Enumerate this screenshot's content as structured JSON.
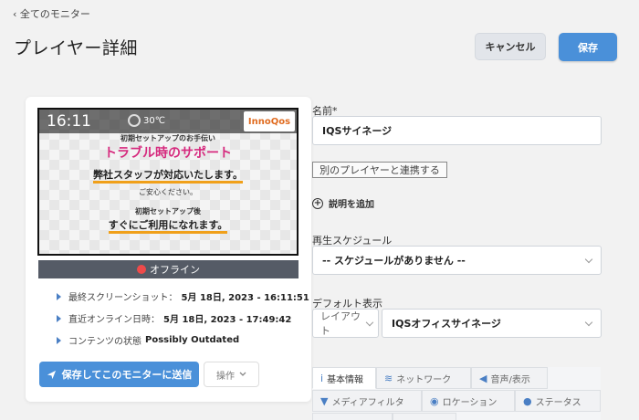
{
  "header": {
    "back_link": "‹ 全てのモニター",
    "title": "プレイヤー詳細",
    "cancel_label": "キャンセル",
    "save_label": "保存"
  },
  "preview": {
    "time": "16:11",
    "weather_icon": "sun-icon",
    "temperature": "30℃",
    "logo_text": "InnoQos",
    "line1": "初期セットアップのお手伝い",
    "line2": "トラブル時のサポート",
    "line3": "弊社スタッフが対応いたします。",
    "line4": "ご安心ください。",
    "line5": "初期セットアップ後",
    "line6": "すぐにご利用になれます。"
  },
  "status": {
    "text": "オフライン",
    "color": "#ef4a4a"
  },
  "info": {
    "screenshot_label": "最終スクリーンショット：",
    "screenshot_value": "5月 18日, 2023 - 16:11:51",
    "online_label": "直近オンライン日時：",
    "online_value": "5月 18日, 2023 - 17:49:42",
    "content_label": "コンテンツの状態",
    "content_value": "Possibly Outdated"
  },
  "actions": {
    "send_label": "保存してこのモニターに送信",
    "ops_label": "操作"
  },
  "form": {
    "name_label": "名前*",
    "name_value": "IQSサイネージ",
    "link_label": "別のプレイヤーと連携する",
    "add_desc_label": "説明を追加",
    "schedule_label": "再生スケジュール",
    "schedule_value": "-- スケジュールがありません --",
    "default_label": "デフォルト表示",
    "layout_value": "レイアウト",
    "default_value": "IQSオフィスサイネージ"
  },
  "tabs": [
    {
      "label": "基本情報",
      "icon": "info-icon"
    },
    {
      "label": "ネットワーク",
      "icon": "wifi-icon"
    },
    {
      "label": "音声/表示",
      "icon": "speaker-icon"
    },
    {
      "label": "メディアフィルタ",
      "icon": "filter-icon"
    },
    {
      "label": "ロケーション",
      "icon": "compass-icon"
    },
    {
      "label": "ステータス",
      "icon": "circle-icon"
    }
  ],
  "colors": {
    "primary": "#4a90d9",
    "accent_pink": "#d62a7e"
  }
}
